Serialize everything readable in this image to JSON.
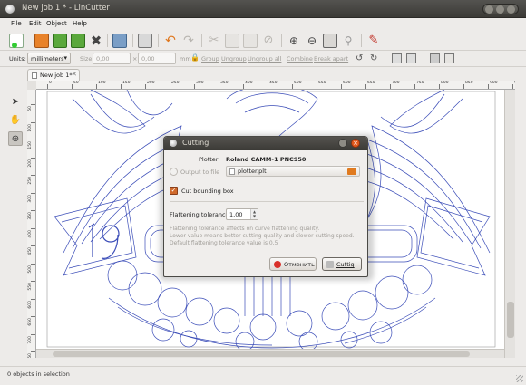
{
  "window": {
    "title": "New job 1 * - LinCutter"
  },
  "menu": [
    "File",
    "Edit",
    "Object",
    "Help"
  ],
  "toolbar_icons": [
    "new-icon",
    "open-icon",
    "save-icon",
    "save-as-icon",
    "delete-icon",
    "import-icon",
    "print-icon",
    "undo-icon",
    "redo-icon",
    "cut-icon",
    "copy-icon",
    "paste-icon",
    "stop-icon",
    "zoom-in-icon",
    "zoom-out-icon",
    "zoom-fit-icon",
    "zoom-icon",
    "settings-icon"
  ],
  "propbar": {
    "units_label": "Units:",
    "units_value": "millimeters",
    "size_label": "Size:",
    "width_value": "0,00",
    "times": "×",
    "height_value": "0,00",
    "mm": "mm",
    "group": "Group",
    "ungroup": "Ungroup",
    "ungroup_all": "Ungroup all",
    "combine": "Combine",
    "break_apart": "Break apart"
  },
  "tab": {
    "label": "New job 1*"
  },
  "ruler": {
    "h_ticks": [
      "0",
      "50",
      "100",
      "150",
      "200",
      "250",
      "300",
      "350",
      "400",
      "450",
      "500",
      "550",
      "600",
      "650",
      "700",
      "750",
      "800",
      "850",
      "900",
      "950"
    ],
    "v_ticks": [
      "50",
      "100",
      "150",
      "200",
      "250",
      "300",
      "350",
      "400",
      "450",
      "500",
      "550",
      "600",
      "650",
      "700",
      "750"
    ]
  },
  "dialog": {
    "title": "Cutting",
    "plotter_label": "Plotter:",
    "plotter_value": "Roland CAMM-1 PNC950",
    "output_to_file": "Output to file",
    "file_name": "plotter.plt",
    "cut_bounding_box": "Cut bounding box",
    "flattening_label": "Flattening tolerance:",
    "flattening_value": "1,00",
    "help_line1": "Flattening tolerance affects on curve flattening quality.",
    "help_line2": "Lower value means better cutting quality and slower cutting speed.",
    "help_line3": "Default flattening tolerance value is 0,5",
    "cancel_label": "Отменить",
    "cutting_label": "Cuttig"
  },
  "status": {
    "text": "0 objects in selection"
  },
  "colors": {
    "artwork": "#3b4db8",
    "accent": "#d06a2c",
    "close": "#e2581c"
  }
}
